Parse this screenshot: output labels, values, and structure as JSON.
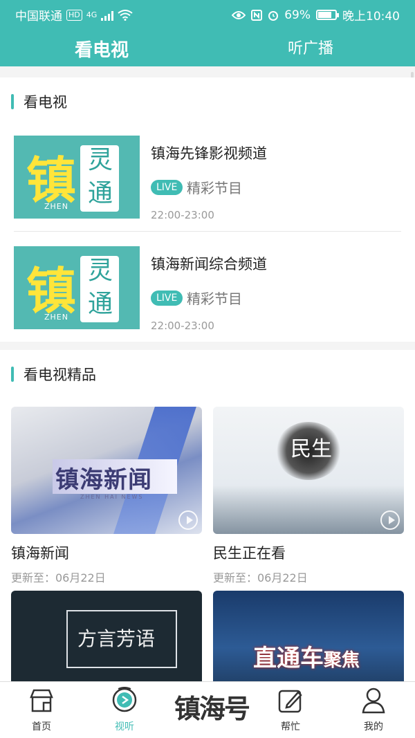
{
  "status_bar": {
    "carrier": "中国联通",
    "hd": "HD",
    "network": "4G",
    "battery": "69%",
    "time": "晚上10:40"
  },
  "header": {
    "tabs": [
      {
        "label": "看电视",
        "active": true
      },
      {
        "label": "听广播",
        "active": false
      }
    ]
  },
  "tv_section": {
    "title": "看电视",
    "channels": [
      {
        "name": "镇海先锋影视频道",
        "badge": "LIVE",
        "program": "精彩节目",
        "time": "22:00-23:00",
        "thumb_main": "镇",
        "thumb_side": "灵通",
        "thumb_sub": "ZHEN"
      },
      {
        "name": "镇海新闻综合频道",
        "badge": "LIVE",
        "program": "精彩节目",
        "time": "22:00-23:00",
        "thumb_main": "镇",
        "thumb_side": "灵通",
        "thumb_sub": "ZHEN"
      }
    ]
  },
  "picks_section": {
    "title": "看电视精品",
    "items": [
      {
        "title": "镇海新闻",
        "updated": "更新至：06月22日",
        "img_text": "镇海新闻",
        "img_sub": "ZHEN HAI NEWS"
      },
      {
        "title": "民生正在看",
        "updated": "更新至：06月22日",
        "img_text": "民生"
      },
      {
        "img_text": "方言芳语"
      },
      {
        "img_text": "直通车",
        "img_text_small": "聚焦"
      }
    ]
  },
  "bottom_nav": {
    "items": [
      {
        "label": "首页",
        "icon": "home-icon"
      },
      {
        "label": "视听",
        "icon": "play-circle-icon",
        "active": true
      },
      {
        "label": "镇海号",
        "icon": "logo"
      },
      {
        "label": "帮忙",
        "icon": "edit-icon"
      },
      {
        "label": "我的",
        "icon": "user-icon"
      }
    ]
  },
  "colors": {
    "accent": "#40bcb4"
  }
}
